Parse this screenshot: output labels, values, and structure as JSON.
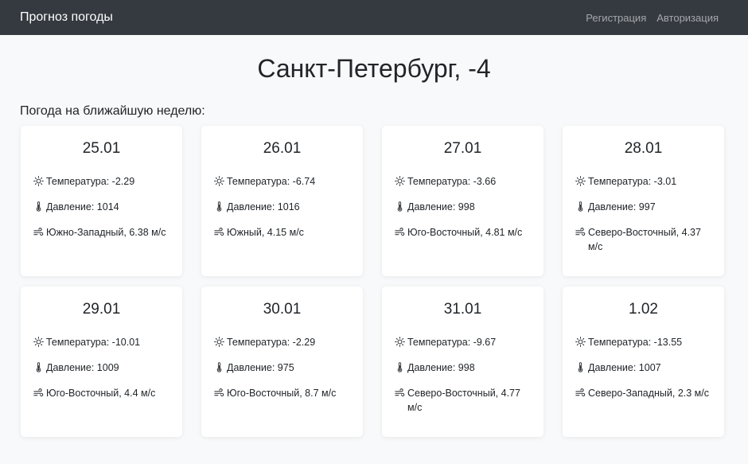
{
  "navbar": {
    "brand": "Прогноз погоды",
    "links": [
      {
        "label": "Регистрация"
      },
      {
        "label": "Авторизация"
      }
    ]
  },
  "header": {
    "title": "Санкт-Петербург, -4",
    "subtitle": "Погода на ближайшую неделю:"
  },
  "icons": {
    "temperature": "sun-icon",
    "pressure": "thermometer-icon",
    "wind": "wind-icon"
  },
  "forecast": [
    {
      "date": "25.01",
      "temperature": "Температура: -2.29",
      "pressure": "Давление: 1014",
      "wind": "Южно-Западный, 6.38 м/с"
    },
    {
      "date": "26.01",
      "temperature": "Температура: -6.74",
      "pressure": "Давление: 1016",
      "wind": "Южный, 4.15 м/с"
    },
    {
      "date": "27.01",
      "temperature": "Температура: -3.66",
      "pressure": "Давление: 998",
      "wind": "Юго-Восточный, 4.81 м/с"
    },
    {
      "date": "28.01",
      "temperature": "Температура: -3.01",
      "pressure": "Давление: 997",
      "wind": "Северо-Восточный, 4.37 м/с"
    },
    {
      "date": "29.01",
      "temperature": "Температура: -10.01",
      "pressure": "Давление: 1009",
      "wind": "Юго-Восточный, 4.4 м/с"
    },
    {
      "date": "30.01",
      "temperature": "Температура: -2.29",
      "pressure": "Давление: 975",
      "wind": "Юго-Восточный, 8.7 м/с"
    },
    {
      "date": "31.01",
      "temperature": "Температура: -9.67",
      "pressure": "Давление: 998",
      "wind": "Северо-Восточный, 4.77 м/с"
    },
    {
      "date": "1.02",
      "temperature": "Температура: -13.55",
      "pressure": "Давление: 1007",
      "wind": "Северо-Западный, 2.3 м/с"
    }
  ]
}
